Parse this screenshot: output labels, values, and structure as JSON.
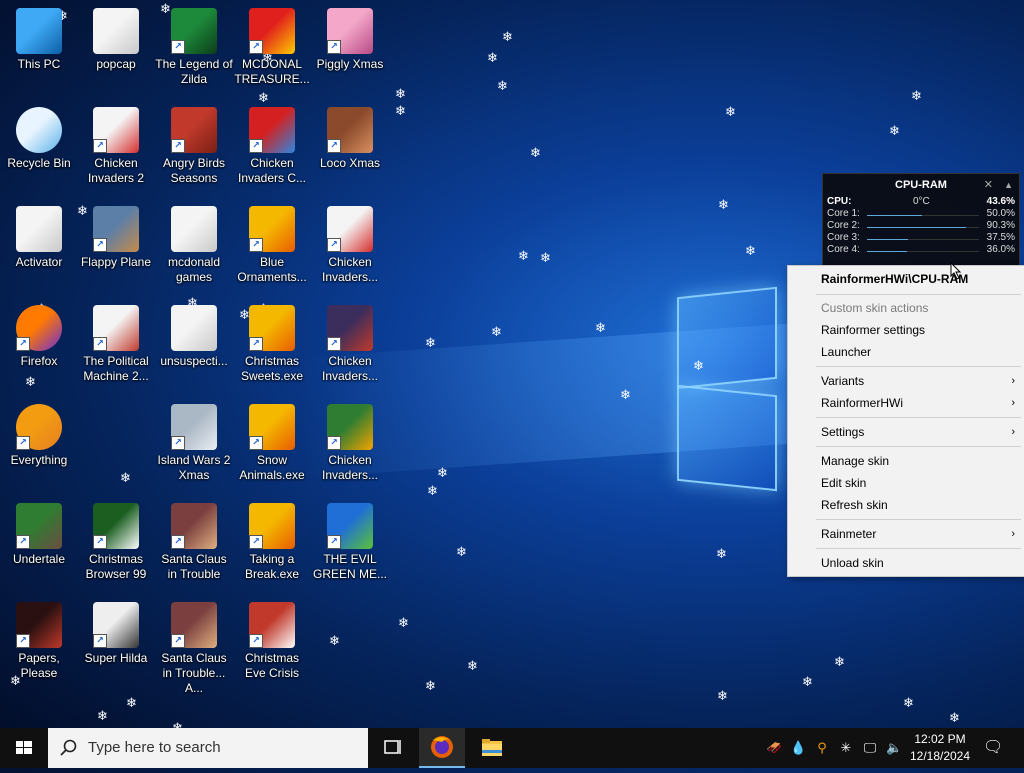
{
  "desktop": {
    "icons": [
      {
        "label": "This PC"
      },
      {
        "label": "popcap"
      },
      {
        "label": "The Legend of Zilda"
      },
      {
        "label": "MCDONAL TREASURE..."
      },
      {
        "label": "Piggly Xmas"
      },
      {
        "label": "Recycle Bin"
      },
      {
        "label": "Chicken Invaders 2"
      },
      {
        "label": "Angry Birds Seasons"
      },
      {
        "label": "Chicken Invaders C..."
      },
      {
        "label": "Loco Xmas"
      },
      {
        "label": "Activator"
      },
      {
        "label": "Flappy Plane"
      },
      {
        "label": "mcdonald games"
      },
      {
        "label": "Blue Ornaments..."
      },
      {
        "label": "Chicken Invaders..."
      },
      {
        "label": "Firefox"
      },
      {
        "label": "The Political Machine 2..."
      },
      {
        "label": "unsuspecti..."
      },
      {
        "label": "Christmas Sweets.exe"
      },
      {
        "label": "Chicken Invaders..."
      },
      {
        "label": "Everything"
      },
      {
        "label": "Island Wars 2 Xmas"
      },
      {
        "label": "Snow Animals.exe"
      },
      {
        "label": "Chicken Invaders..."
      },
      {
        "label": "Undertale"
      },
      {
        "label": "Christmas Browser 99"
      },
      {
        "label": "Santa Claus in Trouble"
      },
      {
        "label": "Taking a Break.exe"
      },
      {
        "label": "THE EVIL GREEN ME..."
      },
      {
        "label": "Papers, Please"
      },
      {
        "label": "Super Hilda"
      },
      {
        "label": "Santa Claus in Trouble... A..."
      },
      {
        "label": "Christmas Eve Crisis"
      }
    ]
  },
  "widget": {
    "title": "CPU-RAM",
    "cpu_label": "CPU:",
    "temp": "0°C",
    "cpu_value": "43.6%",
    "cores": [
      {
        "name": "Core 1:",
        "value": "50.0%",
        "level": 0.5
      },
      {
        "name": "Core 2:",
        "value": "90.3%",
        "level": 0.9
      },
      {
        "name": "Core 3:",
        "value": "37.5%",
        "level": 0.375
      },
      {
        "name": "Core 4:",
        "value": "36.0%",
        "level": 0.36
      }
    ]
  },
  "menu": {
    "header": "RainformerHWi\\CPU-RAM",
    "custom_actions": "Custom skin actions",
    "rainformer_settings": "Rainformer settings",
    "launcher": "Launcher",
    "variants": "Variants",
    "rainformerhwi": "RainformerHWi",
    "settings": "Settings",
    "manage_skin": "Manage skin",
    "edit_skin": "Edit skin",
    "refresh_skin": "Refresh skin",
    "rainmeter": "Rainmeter",
    "unload_skin": "Unload skin",
    "arrow": "›"
  },
  "taskbar": {
    "search_placeholder": "Type here to search",
    "time": "12:02 PM",
    "date": "12/18/2024"
  }
}
